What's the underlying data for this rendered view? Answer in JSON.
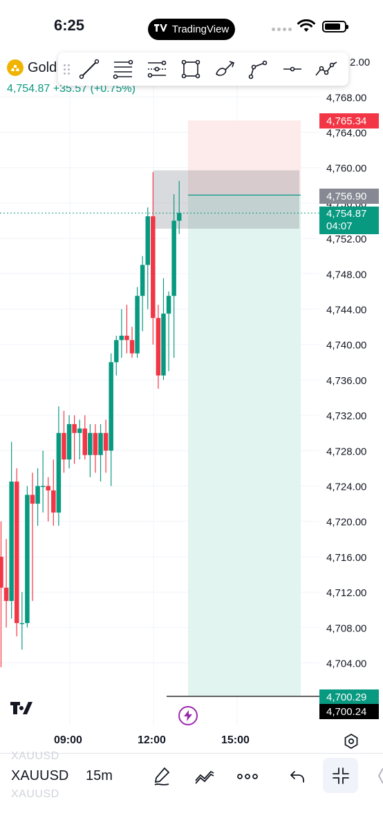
{
  "status_bar": {
    "time": "6:25",
    "app_pill_label": "TradingView"
  },
  "symbol_header": {
    "name": "Gold",
    "last_price": "4,754.87",
    "change": "+35.57 (+0.75%)",
    "icon": "gold-bars-icon"
  },
  "drawing_toolbar": {
    "tools": [
      "trend-line-icon",
      "fib-retracement-icon",
      "pitchfork-icon",
      "rectangle-icon",
      "brush-icon",
      "path-icon",
      "horizontal-line-icon",
      "pattern-icon"
    ]
  },
  "price_tags": {
    "stop": "4,765.34",
    "entry": "4,756.90",
    "current": "4,754.87",
    "countdown": "04:07",
    "target": "4,700.29",
    "crosshair": "4,700.24"
  },
  "colors": {
    "up": "#089981",
    "down": "#f23645",
    "entry_gray": "#868993",
    "profit_zone": "#e1f4ef",
    "loss_zone": "#fdeaea"
  },
  "chart_data": {
    "type": "candlestick",
    "title": "",
    "symbol": "XAUUSD",
    "interval": "15m",
    "y_ticks": [
      "2.00",
      "4,768.00",
      "4,764.00",
      "4,760.00",
      "4,756.00",
      "4,752.00",
      "4,748.00",
      "4,744.00",
      "4,740.00",
      "4,736.00",
      "4,732.00",
      "4,728.00",
      "4,724.00",
      "4,720.00",
      "4,716.00",
      "4,712.00",
      "4,708.00",
      "4,704.00"
    ],
    "x_ticks": [
      "09:00",
      "12:00",
      "15:00"
    ],
    "ylim": [
      4698.5,
      4772.5
    ],
    "candles": [
      {
        "o": 4716.0,
        "h": 4720.0,
        "l": 4703.5,
        "c": 4712.5
      },
      {
        "o": 4712.5,
        "h": 4718.0,
        "l": 4708.0,
        "c": 4711.0
      },
      {
        "o": 4711.0,
        "h": 4729.0,
        "l": 4709.0,
        "c": 4724.5
      },
      {
        "o": 4724.5,
        "h": 4726.0,
        "l": 4707.0,
        "c": 4708.5
      },
      {
        "o": 4708.5,
        "h": 4712.0,
        "l": 4705.5,
        "c": 4708.5
      },
      {
        "o": 4708.5,
        "h": 4724.0,
        "l": 4708.0,
        "c": 4723.0
      },
      {
        "o": 4723.0,
        "h": 4725.5,
        "l": 4711.0,
        "c": 4722.0
      },
      {
        "o": 4722.0,
        "h": 4726.0,
        "l": 4719.5,
        "c": 4724.0
      },
      {
        "o": 4724.0,
        "h": 4728.0,
        "l": 4721.0,
        "c": 4724.0
      },
      {
        "o": 4724.0,
        "h": 4725.0,
        "l": 4720.0,
        "c": 4723.5
      },
      {
        "o": 4723.5,
        "h": 4727.0,
        "l": 4719.5,
        "c": 4721.0
      },
      {
        "o": 4721.0,
        "h": 4733.0,
        "l": 4719.5,
        "c": 4730.0
      },
      {
        "o": 4730.0,
        "h": 4732.5,
        "l": 4725.5,
        "c": 4727.0
      },
      {
        "o": 4727.0,
        "h": 4732.0,
        "l": 4726.0,
        "c": 4731.0
      },
      {
        "o": 4731.0,
        "h": 4732.0,
        "l": 4726.5,
        "c": 4730.0
      },
      {
        "o": 4730.0,
        "h": 4731.5,
        "l": 4727.0,
        "c": 4730.5
      },
      {
        "o": 4730.5,
        "h": 4732.0,
        "l": 4727.0,
        "c": 4727.5
      },
      {
        "o": 4727.5,
        "h": 4731.0,
        "l": 4725.0,
        "c": 4730.0
      },
      {
        "o": 4730.0,
        "h": 4731.0,
        "l": 4725.5,
        "c": 4727.5
      },
      {
        "o": 4727.5,
        "h": 4731.0,
        "l": 4724.5,
        "c": 4730.0
      },
      {
        "o": 4730.0,
        "h": 4731.5,
        "l": 4725.5,
        "c": 4728.0
      },
      {
        "o": 4728.0,
        "h": 4739.0,
        "l": 4724.0,
        "c": 4738.0
      },
      {
        "o": 4738.0,
        "h": 4741.0,
        "l": 4736.5,
        "c": 4740.5
      },
      {
        "o": 4740.5,
        "h": 4744.0,
        "l": 4738.5,
        "c": 4741.0
      },
      {
        "o": 4741.0,
        "h": 4744.5,
        "l": 4739.0,
        "c": 4740.5
      },
      {
        "o": 4740.5,
        "h": 4742.0,
        "l": 4738.5,
        "c": 4739.0
      },
      {
        "o": 4739.0,
        "h": 4746.5,
        "l": 4738.5,
        "c": 4745.5
      },
      {
        "o": 4745.5,
        "h": 4750.0,
        "l": 4741.5,
        "c": 4749.0
      },
      {
        "o": 4749.0,
        "h": 4755.5,
        "l": 4744.0,
        "c": 4754.5
      },
      {
        "o": 4754.5,
        "h": 4759.5,
        "l": 4740.0,
        "c": 4743.0
      },
      {
        "o": 4743.0,
        "h": 4744.5,
        "l": 4735.0,
        "c": 4736.5
      },
      {
        "o": 4736.5,
        "h": 4747.5,
        "l": 4736.0,
        "c": 4743.5
      },
      {
        "o": 4743.5,
        "h": 4746.0,
        "l": 4737.0,
        "c": 4745.5
      },
      {
        "o": 4745.5,
        "h": 4757.0,
        "l": 4738.5,
        "c": 4754.0
      },
      {
        "o": 4754.0,
        "h": 4758.5,
        "l": 4752.5,
        "c": 4754.87
      }
    ],
    "entry_price": 4756.9,
    "stop_price": 4765.34,
    "target_price": 4700.29,
    "current_price": 4754.87,
    "grid": true
  },
  "bottom_toolbar": {
    "symbol": "XAUUSD",
    "interval": "15m",
    "ghost_symbol": "XAUUSD"
  }
}
